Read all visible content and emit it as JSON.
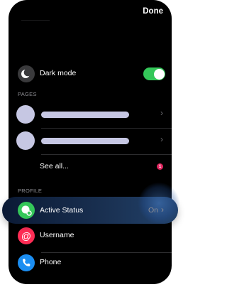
{
  "header": {
    "done_label": "Done"
  },
  "dark_mode": {
    "label": "Dark mode",
    "enabled": true,
    "icon": "moon-icon"
  },
  "pages": {
    "section_title": "PAGES",
    "items": [
      {
        "avatar": "page-avatar-placeholder"
      },
      {
        "avatar": "page-avatar-placeholder"
      }
    ],
    "see_all_label": "See all...",
    "see_all_badge": "1"
  },
  "profile": {
    "section_title": "PROFILE",
    "active_status": {
      "label": "Active Status",
      "value": "On",
      "icon": "active-status-icon",
      "color": "#34c759"
    },
    "username": {
      "label": "Username",
      "icon": "at-icon",
      "color": "#ff2d55"
    },
    "phone": {
      "label": "Phone",
      "icon": "phone-icon",
      "color": "#1b8ef2"
    }
  }
}
